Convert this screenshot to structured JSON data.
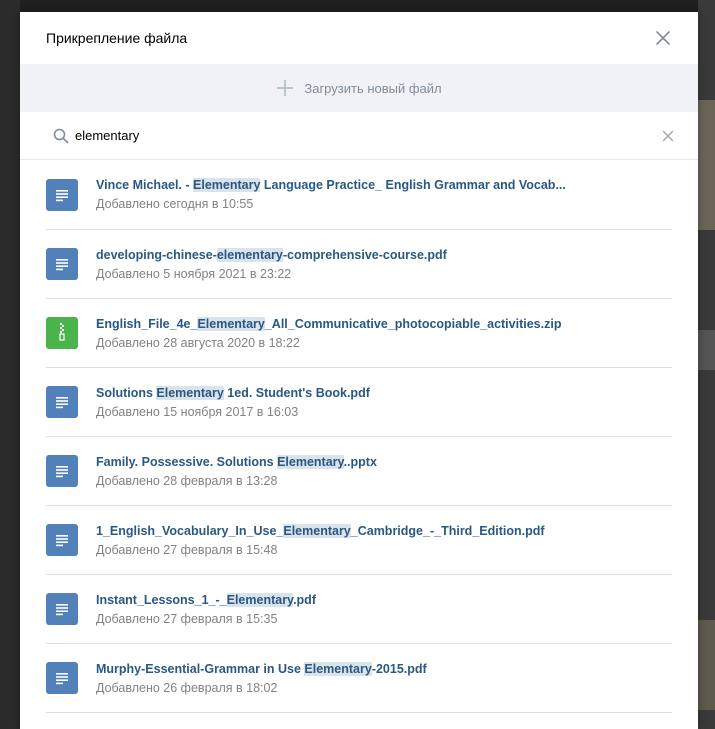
{
  "dialog": {
    "title": "Прикрепление файла"
  },
  "upload": {
    "label": "Загрузить новый файл"
  },
  "search": {
    "value": "elementary",
    "placeholder": ""
  },
  "files": [
    {
      "type": "doc",
      "name_parts": [
        "Vince Michael. - ",
        "Elementary",
        " Language Practice_ English Grammar and Vocab..."
      ],
      "date": "Добавлено сегодня в 10:55"
    },
    {
      "type": "doc",
      "name_parts": [
        "developing-chinese-",
        "elementary",
        "-comprehensive-course.pdf"
      ],
      "date": "Добавлено 5 ноября 2021 в 23:22"
    },
    {
      "type": "zip",
      "name_parts": [
        "English_File_4e_",
        "Elementary",
        "_All_Communicative_photocopiable_activities.zip"
      ],
      "date": "Добавлено 28 августа 2020 в 18:22"
    },
    {
      "type": "doc",
      "name_parts": [
        "Solutions ",
        "Elementary",
        " 1ed. Student's Book.pdf"
      ],
      "date": "Добавлено 15 ноября 2017 в 16:03"
    },
    {
      "type": "doc",
      "name_parts": [
        "Family. Possessive. Solutions ",
        "Elementary",
        "..pptx"
      ],
      "date": "Добавлено 28 февраля в 13:28"
    },
    {
      "type": "doc",
      "name_parts": [
        "1_English_Vocabulary_In_Use_",
        "Elementary",
        "_Cambridge_-_Third_Edition.pdf"
      ],
      "date": "Добавлено 27 февраля в 15:48"
    },
    {
      "type": "doc",
      "name_parts": [
        "Instant_Lessons_1_-_",
        "Elementary",
        ".pdf"
      ],
      "date": "Добавлено 27 февраля в 15:35"
    },
    {
      "type": "doc",
      "name_parts": [
        "Murphy-Essential-Grammar in Use ",
        "Elementary",
        "-2015.pdf"
      ],
      "date": "Добавлено 26 февраля в 18:02"
    }
  ],
  "colors": {
    "link": "#2a5885",
    "doc_icon": "#5181b8",
    "zip_icon": "#4bb34b",
    "highlight": "#dae2ea",
    "muted": "#828282"
  },
  "icons": {
    "close": "close-icon",
    "upload": "plus-icon",
    "search": "search-icon",
    "clear": "clear-icon",
    "doc": "document-icon",
    "zip": "zip-archive-icon"
  }
}
